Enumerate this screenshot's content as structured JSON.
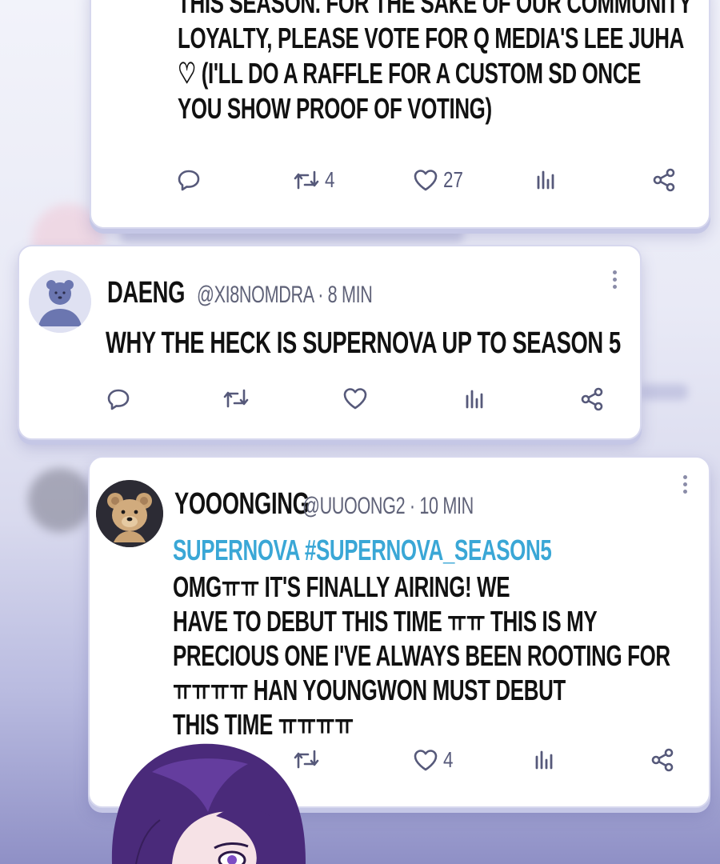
{
  "posts": [
    {
      "body_lines": [
        "THIS SEASON. FOR THE SAKE OF OUR COMMUNITY",
        "LOYALTY, PLEASE VOTE FOR Q MEDIA'S LEE JUHA",
        "♡  (I'LL DO A RAFFLE FOR A CUSTOM SD ONCE",
        "YOU SHOW PROOF OF VOTING)"
      ],
      "retweets": "4",
      "likes": "27"
    },
    {
      "name": "DAENG",
      "handle": "@XI8NOMDRA · 8 MIN",
      "body": "WHY THE HECK IS SUPERNOVA UP TO SEASON 5"
    },
    {
      "name": "YOOONGING",
      "handle": "@UUOONG2 · 10 MIN",
      "hashtags": "SUPERNOVA #SUPERNOVA_SEASON5",
      "body_lines": [
        "OMGㅠㅠ  IT'S FINALLY AIRING! WE",
        "HAVE TO DEBUT THIS TIME ㅠㅠ  THIS IS MY",
        "PRECIOUS ONE I'VE ALWAYS BEEN ROOTING FOR",
        "ㅠㅠㅠㅠ  HAN YOUNGWON MUST DEBUT",
        "THIS TIME ㅠㅠㅠㅠ"
      ],
      "likes": "4"
    }
  ],
  "colors": {
    "hashtag": "#3aa7d6",
    "icon": "#56597a",
    "card_border": "#d7d8ee",
    "hair": "#4a2a7a"
  },
  "icons": [
    "reply-icon",
    "retweet-icon",
    "heart-icon",
    "stats-icon",
    "share-icon",
    "more-icon"
  ]
}
